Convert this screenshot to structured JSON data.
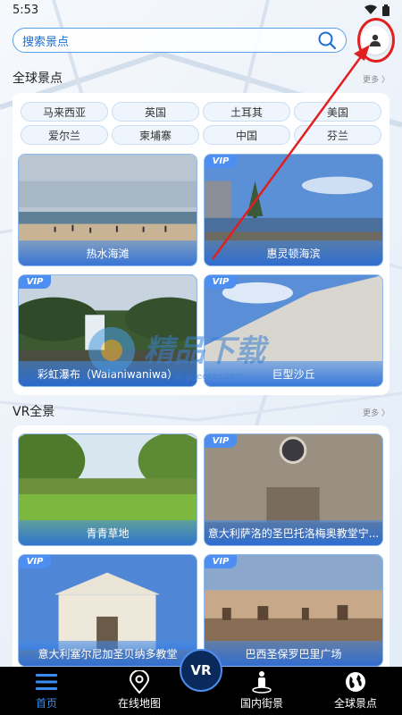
{
  "status_bar": {
    "time": "5:53"
  },
  "search": {
    "placeholder": "搜索景点"
  },
  "global_section": {
    "title": "全球景点",
    "more": "更多 〉",
    "countries": [
      "马来西亚",
      "英国",
      "土耳其",
      "美国",
      "爱尔兰",
      "柬埔寨",
      "中国",
      "芬兰"
    ],
    "spots": [
      {
        "label": "热水海滩",
        "vip": false
      },
      {
        "label": "惠灵顿海滨",
        "vip": true
      },
      {
        "label": "彩虹瀑布（Waianiwaniwa）",
        "vip": true
      },
      {
        "label": "巨型沙丘",
        "vip": true
      }
    ]
  },
  "vr_section": {
    "title": "VR全景",
    "more": "更多 〉",
    "spots": [
      {
        "label": "青青草地",
        "vip": false
      },
      {
        "label": "意大利萨洛的圣巴托洛梅奥教堂宁...",
        "vip": true
      },
      {
        "label": "意大利塞尔尼加圣贝纳多教堂",
        "vip": true
      },
      {
        "label": "巴西圣保罗巴里广场",
        "vip": true
      }
    ]
  },
  "vip_text": "VIP",
  "watermark": {
    "text": "精品下载",
    "subtext": "jp.ggeeses.com"
  },
  "nav": {
    "vr_label": "VR",
    "items": [
      {
        "label": "首页",
        "icon": "menu-icon"
      },
      {
        "label": "在线地图",
        "icon": "map-pin-icon"
      },
      {
        "label": "国内街景",
        "icon": "street-view-icon"
      },
      {
        "label": "全球景点",
        "icon": "globe-icon"
      }
    ]
  },
  "colors": {
    "accent": "#3b8cf0",
    "annotation": "#e02020",
    "nav_bg": "#000000"
  }
}
